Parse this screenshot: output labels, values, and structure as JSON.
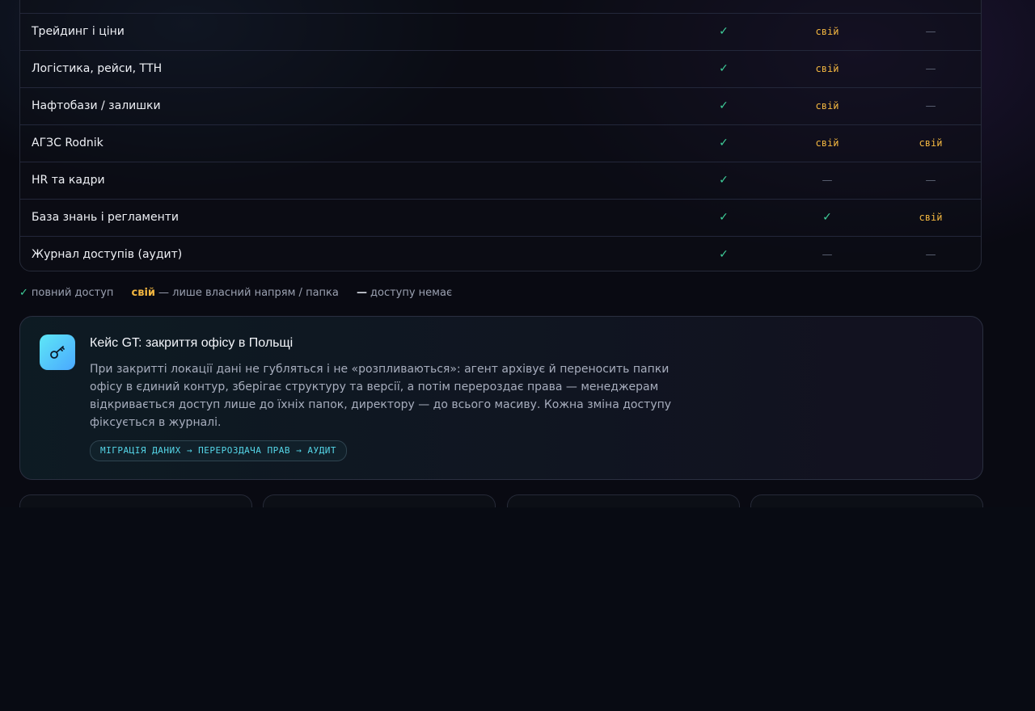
{
  "table": {
    "rows": [
      {
        "label": "Трейдинг і ціни",
        "c1": "✓",
        "c2": "свій",
        "c3": "—"
      },
      {
        "label": "Логістика, рейси, ТТН",
        "c1": "✓",
        "c2": "свій",
        "c3": "—"
      },
      {
        "label": "Нафтобази / залишки",
        "c1": "✓",
        "c2": "свій",
        "c3": "—"
      },
      {
        "label": "АГЗС Rodnik",
        "c1": "✓",
        "c2": "свій",
        "c3": "свій"
      },
      {
        "label": "HR та кадри",
        "c1": "✓",
        "c2": "—",
        "c3": "—"
      },
      {
        "label": "База знань і регламенти",
        "c1": "✓",
        "c2": "✓",
        "c3": "свій"
      },
      {
        "label": "Журнал доступів (аудит)",
        "c1": "✓",
        "c2": "—",
        "c3": "—"
      }
    ]
  },
  "legend": {
    "full_symbol": "✓",
    "full_text": "повний доступ",
    "own_symbol": "свій",
    "own_text": "— лише власний напрям / папка",
    "none_symbol": "—",
    "none_text": "доступу немає"
  },
  "case": {
    "icon": "key-icon",
    "title": "Кейс GT: закриття офісу в Польщі",
    "description": "При закритті локації дані не губляться і не «розпливаються»: агент архівує й переносить папки офісу в єдиний контур, зберігає структуру та версії, а потім перероздає права — менеджерам відкривається доступ лише до їхніх папок, директору — до всього масиву. Кожна зміна доступу фіксується в журналі.",
    "tag": "МІГРАЦІЯ ДАНИХ → ПЕРЕРОЗДАЧА ПРАВ → АУДИТ"
  },
  "colors": {
    "check": "#3fcf9a",
    "own": "#f2b640",
    "none": "#5b6072",
    "accent": "#55d6e8"
  }
}
